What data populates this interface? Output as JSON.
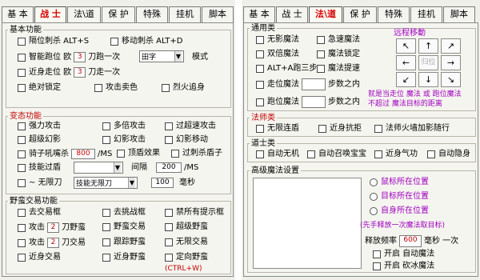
{
  "left": {
    "tabs": [
      "基 本",
      "战 士",
      "法\\道",
      "保 护",
      "特殊",
      "挂机",
      "脚本"
    ],
    "basic": {
      "title": "基本功能",
      "r1a": "隔位刺杀 ALT+S",
      "r1b": "移动刺杀 ALT+D",
      "r2a": "智能跑位 欧",
      "r2a_val": "3",
      "r2a_suf": "刀跑一次",
      "r2_select": "田字",
      "r2_mode": "模式",
      "r3a": "近身走位 欧",
      "r3a_val": "3",
      "r3a_suf": "刀走一次",
      "r4a": "绝对锁定",
      "r4b": "攻击卖色",
      "r4c": "烈火追身"
    },
    "change": {
      "title": "变态功能",
      "c1": [
        "强力攻击",
        "多倍攻击",
        "过超速攻击"
      ],
      "c2": [
        "超级幻影",
        "幻影攻击",
        "幻影移动"
      ],
      "c3a": "骑子吼嘴杀",
      "c3a_val": "800",
      "c3a_unit": "/MS",
      "c3b": "顶盾效果",
      "c3c": "过刺杀盾子",
      "c4a": "技能过盾",
      "c4_interval": "间隔",
      "c4_val": "200",
      "c4_unit": "/MS",
      "c5a": "~ 无限刀",
      "c5_select": "技能无限刀",
      "c5_val": "100",
      "c5_unit": "毫秒"
    },
    "trade": {
      "title": "野蛮交易功能",
      "t1": [
        "去交易框",
        "去挑战框",
        "禁所有提示框"
      ],
      "t2a": "攻击",
      "t2a_val": "2",
      "t2a_suf": "刀野蛮",
      "t2b": "野蛮交易",
      "t2c": "超级野蛮",
      "t3a": "攻击",
      "t3a_val": "2",
      "t3a_suf": "刀交易",
      "t3b": "跟踪野蛮",
      "t3c": "无限交易",
      "t4a": "近身交易",
      "t4b": "近身野蛮",
      "t4c": "定向野蛮",
      "t4_hotkey": "(CTRL+W)"
    }
  },
  "right": {
    "tabs": [
      "基 本",
      "战 士",
      "法\\道",
      "保 护",
      "特殊",
      "挂机",
      "脚本"
    ],
    "general": {
      "title": "通用类",
      "g1": "无影魔法",
      "g2": "双倍魔法",
      "g3": "ALT+A跑三步",
      "g4": "走位魔法",
      "g4_suf": "步数之内",
      "g5": "跑位魔法",
      "g5_suf": "步数之内",
      "h1": "急速魔法",
      "h2": "魔法锁定",
      "h3": "魔法提速",
      "dir_title": "远程移動",
      "dir_btns": [
        "↖",
        "↑",
        "↗",
        "←",
        "归位",
        "→",
        "↙",
        "↓",
        "↘"
      ],
      "note1": "就是当走位 魔法 或 跑位魔法",
      "note2": "不超过 魔法目标的距离"
    },
    "mage": {
      "title": "法师类",
      "m": [
        "无限连盾",
        "近身抗拒",
        "法师火墙加影随行"
      ]
    },
    "taoist": {
      "title": "道士类",
      "d": [
        "自动无机",
        "自动召唤宝宝",
        "近身气功",
        "自动隐身"
      ]
    },
    "advanced": {
      "title": "高级魔法设置",
      "radios": [
        "鼠标所在位置",
        "目标所在位置",
        "自身所在位置"
      ],
      "note": "(先手释放一次魔法取目标)",
      "freq_label": "释放频率",
      "freq_val": "600",
      "freq_unit": "毫秒 一次",
      "o1": "开启  自动魔法",
      "o2": "开启  砍冰魔法"
    }
  },
  "colors": {
    "red": "#c00000",
    "purple": "#a000c0",
    "panel": "#f0f0ea"
  }
}
